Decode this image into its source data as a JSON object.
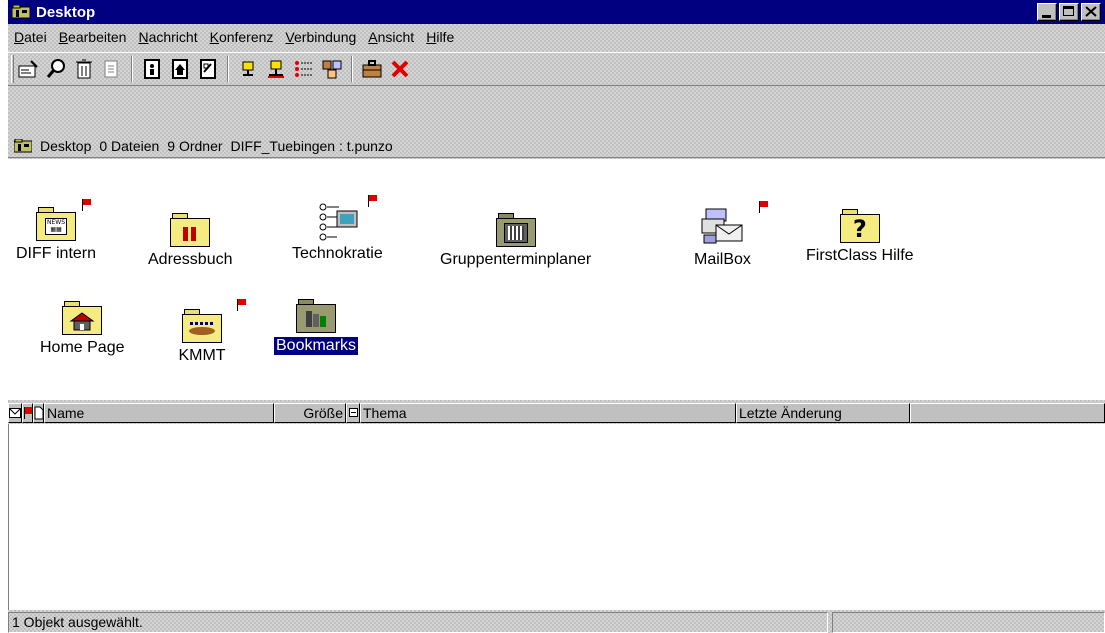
{
  "window": {
    "title": "Desktop"
  },
  "menu": [
    "Datei",
    "Bearbeiten",
    "Nachricht",
    "Konferenz",
    "Verbindung",
    "Ansicht",
    "Hilfe"
  ],
  "menu_underline": [
    "D",
    "B",
    "N",
    "K",
    "V",
    "A",
    "H"
  ],
  "path": {
    "folder": "Desktop",
    "files": "0 Dateien",
    "folders": "9 Ordner",
    "location": "DIFF_Tuebingen : t.punzo"
  },
  "icons": [
    {
      "label": "DIFF intern",
      "flag": true
    },
    {
      "label": "Adressbuch",
      "flag": false
    },
    {
      "label": "Technokratie",
      "flag": true
    },
    {
      "label": "Gruppenterminplaner",
      "flag": false
    },
    {
      "label": "MailBox",
      "flag": true
    },
    {
      "label": "FirstClass Hilfe",
      "flag": false
    },
    {
      "label": "Home Page",
      "flag": false
    },
    {
      "label": "KMMT",
      "flag": true
    },
    {
      "label": "Bookmarks",
      "flag": false,
      "selected": true
    }
  ],
  "columns": {
    "name": "Name",
    "size": "Größe",
    "subject": "Thema",
    "modified": "Letzte Änderung"
  },
  "status": {
    "text": "1 Objekt ausgewählt."
  },
  "colors": {
    "titlebar": "#000080",
    "flag": "#e00000",
    "selection": "#000080"
  }
}
